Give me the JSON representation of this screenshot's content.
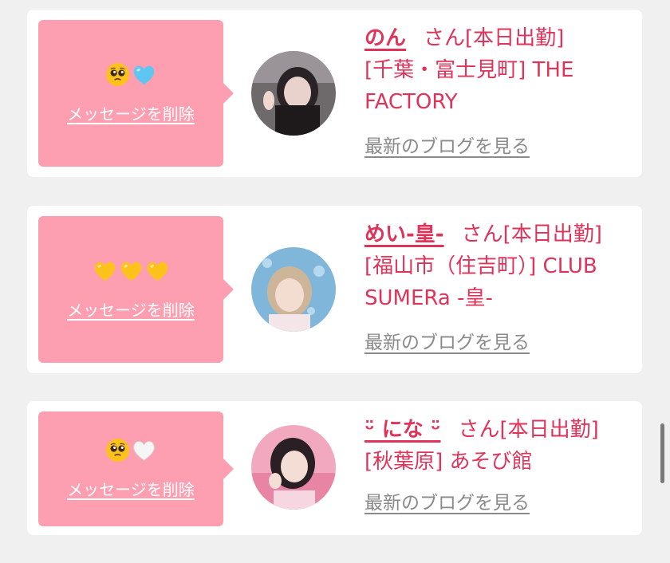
{
  "entries": [
    {
      "emojis": [
        "pleading-face",
        "blue-heart"
      ],
      "delete_label": "メッセージを削除",
      "cast_name": "のん",
      "suffix": "さん[本日出勤]",
      "shop_line1": "[千葉・富士見町] THE",
      "shop_line2": "FACTORY",
      "blog_label": "最新のブログを見る"
    },
    {
      "emojis": [
        "yellow-heart",
        "yellow-heart",
        "yellow-heart"
      ],
      "delete_label": "メッセージを削除",
      "cast_name": "めい-皇-",
      "suffix": "さん[本日出勤]",
      "shop_line1": "[福山市（住吉町）] CLUB",
      "shop_line2": "SUMERa -皇-",
      "blog_label": "最新のブログを見る"
    },
    {
      "emojis": [
        "pleading-face",
        "white-heart"
      ],
      "delete_label": "メッセージを削除",
      "cast_name": "ᵕ̈ にな ᵕ̈",
      "suffix": "さん[本日出勤]",
      "shop_line1": "[秋葉原] あそび館",
      "shop_line2": "",
      "blog_label": "最新のブログを見る"
    }
  ],
  "colors": {
    "background": "#f0f0f1",
    "card": "#ffffff",
    "bubble": "#fd9fb1",
    "accent_text": "#e0335a",
    "link_gray": "#8a8a8a"
  }
}
